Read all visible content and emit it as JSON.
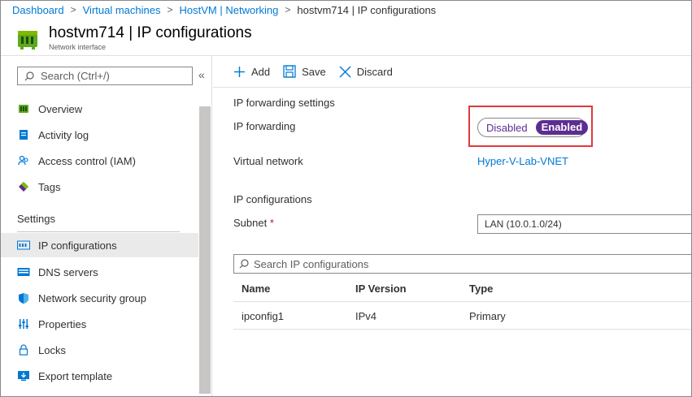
{
  "breadcrumb": [
    "Dashboard",
    "Virtual machines",
    "HostVM | Networking",
    "hostvm714 | IP configurations"
  ],
  "header": {
    "title": "hostvm714 | IP configurations",
    "subtitle": "Network interface",
    "icon": "network-interface-icon"
  },
  "sidebar": {
    "search_placeholder": "Search (Ctrl+/)",
    "collapse": "«",
    "items": [
      {
        "label": "Overview",
        "icon": "overview-icon"
      },
      {
        "label": "Activity log",
        "icon": "activity-log-icon"
      },
      {
        "label": "Access control (IAM)",
        "icon": "iam-icon"
      },
      {
        "label": "Tags",
        "icon": "tag-icon"
      }
    ],
    "settings_label": "Settings",
    "settings_items": [
      {
        "label": "IP configurations",
        "icon": "ip-config-icon",
        "active": true
      },
      {
        "label": "DNS servers",
        "icon": "dns-icon"
      },
      {
        "label": "Network security group",
        "icon": "shield-icon"
      },
      {
        "label": "Properties",
        "icon": "properties-icon"
      },
      {
        "label": "Locks",
        "icon": "lock-icon"
      },
      {
        "label": "Export template",
        "icon": "export-icon"
      }
    ]
  },
  "toolbar": {
    "add_label": "Add",
    "save_label": "Save",
    "discard_label": "Discard"
  },
  "main": {
    "ip_forwarding_heading": "IP forwarding settings",
    "ip_forwarding_label": "IP forwarding",
    "toggle_disabled": "Disabled",
    "toggle_enabled": "Enabled",
    "toggle_value": "Enabled",
    "vnet_label": "Virtual network",
    "vnet_value": "Hyper-V-Lab-VNET",
    "ip_config_heading": "IP configurations",
    "subnet_label": "Subnet",
    "subnet_required": "*",
    "subnet_value": "LAN (10.0.1.0/24)",
    "search_placeholder": "Search IP configurations",
    "table": {
      "columns": [
        "Name",
        "IP Version",
        "Type"
      ],
      "rows": [
        [
          "ipconfig1",
          "IPv4",
          "Primary"
        ]
      ]
    }
  },
  "colors": {
    "accent": "#0078d4",
    "toggle": "#5c2d91",
    "highlight": "#e0393e"
  }
}
